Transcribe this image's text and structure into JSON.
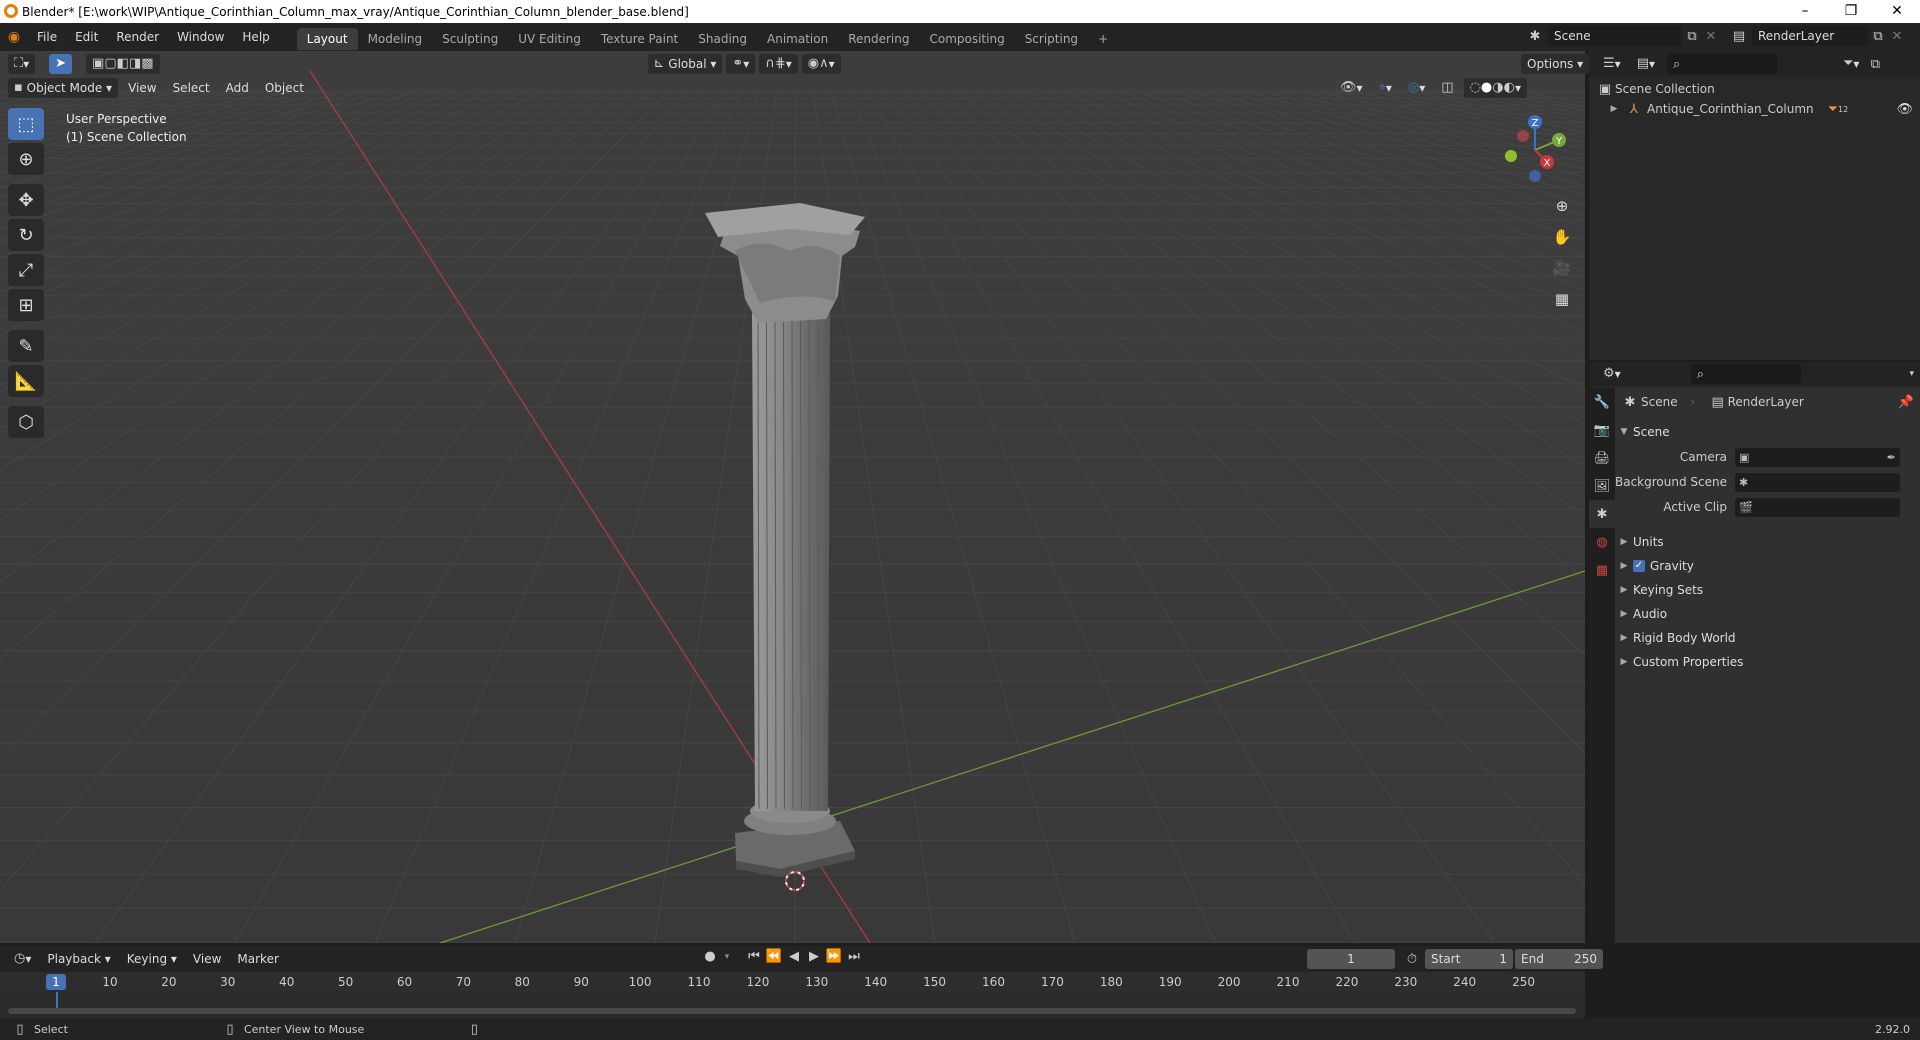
{
  "window": {
    "title": "Blender* [E:\\work\\WIP\\Antique_Corinthian_Column_max_vray/Antique_Corinthian_Column_blender_base.blend]",
    "minimize": "–",
    "maximize": "❐",
    "close": "✕"
  },
  "menu": [
    "File",
    "Edit",
    "Render",
    "Window",
    "Help"
  ],
  "workspaces": [
    "Layout",
    "Modeling",
    "Sculpting",
    "UV Editing",
    "Texture Paint",
    "Shading",
    "Animation",
    "Rendering",
    "Compositing",
    "Scripting"
  ],
  "workspace_add": "+",
  "scene_selector": {
    "value": "Scene"
  },
  "view_layer_selector": {
    "value": "RenderLayer"
  },
  "viewport": {
    "transform_orientation": "Global",
    "options_label": "Options",
    "mode": "Object Mode",
    "menus": [
      "View",
      "Select",
      "Add",
      "Object"
    ],
    "overlay_text_1": "User Perspective",
    "overlay_text_2": "(1) Scene Collection",
    "gizmo": {
      "x": "X",
      "y": "Y",
      "z": "Z"
    }
  },
  "outliner": {
    "root": "Scene Collection",
    "items": [
      {
        "name": "Antique_Corinthian_Column",
        "badge": "12"
      }
    ]
  },
  "properties": {
    "breadcrumb_scene": "Scene",
    "breadcrumb_layer": "RenderLayer",
    "section_title": "Scene",
    "fields": [
      {
        "label": "Camera",
        "value": ""
      },
      {
        "label": "Background Scene",
        "value": ""
      },
      {
        "label": "Active Clip",
        "value": ""
      }
    ],
    "panels": [
      {
        "label": "Units",
        "checkbox": false
      },
      {
        "label": "Gravity",
        "checkbox": true
      },
      {
        "label": "Keying Sets",
        "checkbox": false
      },
      {
        "label": "Audio",
        "checkbox": false
      },
      {
        "label": "Rigid Body World",
        "checkbox": false
      },
      {
        "label": "Custom Properties",
        "checkbox": false
      }
    ]
  },
  "timeline": {
    "menus": [
      "Playback",
      "Keying",
      "View",
      "Marker"
    ],
    "current_frame": "1",
    "start_label": "Start",
    "start_value": "1",
    "end_label": "End",
    "end_value": "250",
    "ruler": [
      "10",
      "20",
      "30",
      "40",
      "50",
      "60",
      "70",
      "80",
      "90",
      "100",
      "110",
      "120",
      "130",
      "140",
      "150",
      "160",
      "170",
      "180",
      "190",
      "200",
      "210",
      "220",
      "230",
      "240",
      "250"
    ],
    "playhead": "1"
  },
  "status": {
    "left": "Select",
    "middle": "Center View to Mouse",
    "version": "2.92.0"
  },
  "colors": {
    "accent": "#4772b3",
    "x_axis": "#c8383f",
    "y_axis": "#78a83a",
    "z_axis": "#3a73c8",
    "brand": "#e87d0d"
  }
}
